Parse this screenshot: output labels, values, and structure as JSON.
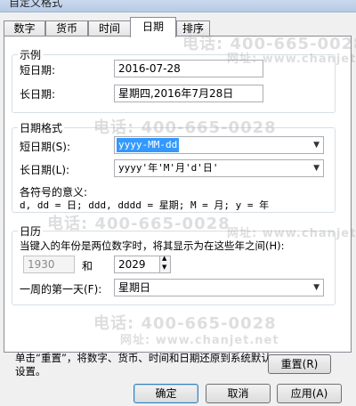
{
  "window": {
    "title": "自定义格式"
  },
  "tabs": [
    {
      "label": "数字"
    },
    {
      "label": "货币"
    },
    {
      "label": "时间"
    },
    {
      "label": "日期"
    },
    {
      "label": "排序"
    }
  ],
  "example": {
    "title": "示例",
    "short_label": "短日期:",
    "short_value": "2016-07-28",
    "long_label": "长日期:",
    "long_value": "星期四,2016年7月28日"
  },
  "date_format": {
    "title": "日期格式",
    "short_label": "短日期(S):",
    "short_value": "yyyy-MM-dd",
    "long_label": "长日期(L):",
    "long_value": "yyyy'年'M'月'd'日'",
    "legend_title": "各符号的意义:",
    "legend_text": "d, dd = 日;  ddd, dddd = 星期;  M = 月;  y = 年"
  },
  "calendar": {
    "title": "日历",
    "two_digit_text": "当键入的年份是两位数字时，将其显示为在这些年之间(H):",
    "year_from": "1930",
    "and_label": "和",
    "year_to": "2029",
    "first_day_label": "一周的第一天(F):",
    "first_day_value": "星期日"
  },
  "reset": {
    "description": "单击“重置”，将数字、货币、时间和日期还原到系统默认设置。",
    "button": "重置(R)"
  },
  "footer": {
    "ok": "确定",
    "cancel": "取消",
    "apply": "应用(A)"
  },
  "watermarks": {
    "phone": "电话: 400-665-0028",
    "site": "网址: www.chanjet.net"
  }
}
